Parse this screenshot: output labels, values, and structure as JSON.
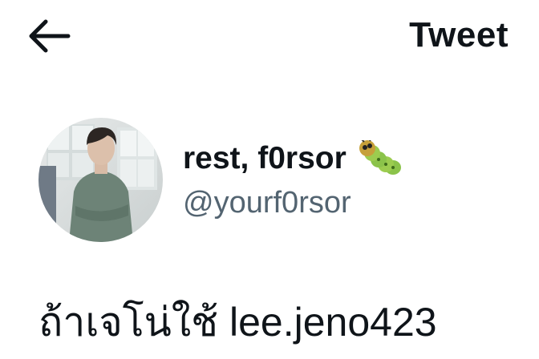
{
  "header": {
    "back_icon": "arrow-left-icon",
    "title": "Tweet"
  },
  "author": {
    "display_name": "rest, f0rsor",
    "name_emoji": "caterpillar-emoji",
    "handle": "@yourf0rsor",
    "avatar": "profile-photo"
  },
  "tweet": {
    "text": "ถ้าเจโน่ใช้ lee.jeno423"
  },
  "colors": {
    "text_primary": "#0f1419",
    "text_secondary": "#536471",
    "background": "#ffffff"
  }
}
